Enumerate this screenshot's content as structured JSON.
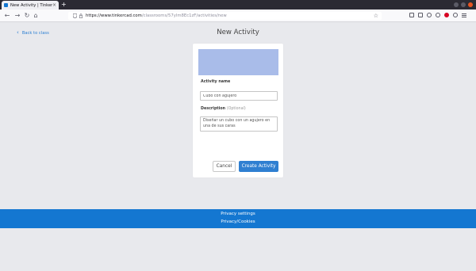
{
  "browser": {
    "tab_title": "New Activity | Tinkercad",
    "tab_close": "×",
    "new_tab": "+",
    "url_host": "https://www.tinkercad.com",
    "url_path": "/classrooms/57ylm8Ec1zF/activities/new",
    "nav": {
      "back": "←",
      "forward": "→",
      "reload": "↻",
      "home": "⌂"
    },
    "star": "☆"
  },
  "page": {
    "back_link": "Back to class",
    "title": "New Activity"
  },
  "form": {
    "activity_name_label": "Activity name",
    "activity_name_value": "Cubo con agujero",
    "description_label": "Description",
    "description_optional": "(Optional)",
    "description_value": "Diseñar un cubo con un agujero en una de sus caras",
    "cancel_label": "Cancel",
    "create_label": "Create Activity"
  },
  "footer": {
    "privacy_settings": "Privacy settings",
    "privacy_cookies": "Privacy/Cookies"
  },
  "colors": {
    "accent": "#2f7fd1",
    "footer": "#1477d1",
    "thumbnail": "#a9bce9",
    "page_bg": "#e8e9ed"
  }
}
